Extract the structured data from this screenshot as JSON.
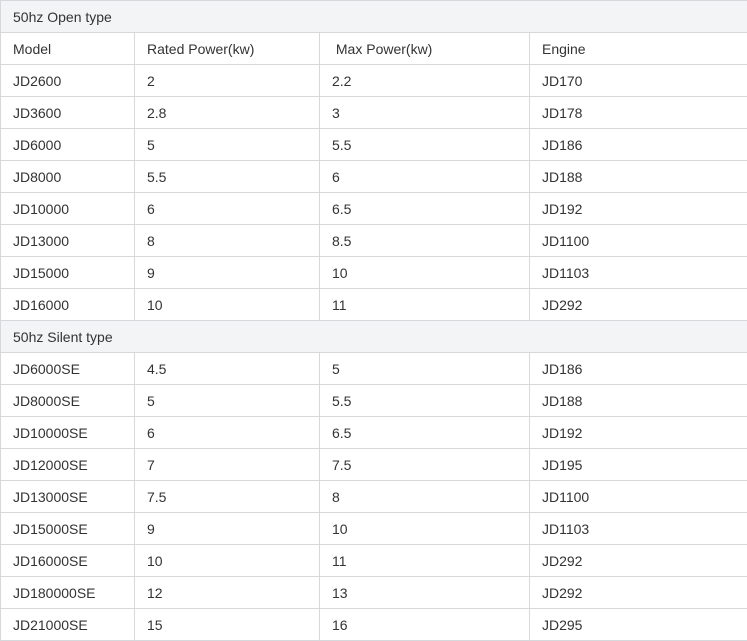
{
  "open_section": {
    "title": "50hz Open type",
    "headers": [
      "Model",
      "Rated Power(kw)",
      " Max Power(kw)",
      "Engine"
    ],
    "rows": [
      [
        "JD2600",
        "2",
        "2.2",
        "JD170"
      ],
      [
        "JD3600",
        "2.8",
        "3",
        "JD178"
      ],
      [
        "JD6000",
        "5",
        "5.5",
        "JD186"
      ],
      [
        "JD8000",
        "5.5",
        "6",
        "JD188"
      ],
      [
        "JD10000",
        "6",
        "6.5",
        "JD192"
      ],
      [
        "JD13000",
        "8",
        "8.5",
        "JD1100"
      ],
      [
        "JD15000",
        "9",
        "10",
        "JD1103"
      ],
      [
        "JD16000",
        "10",
        "11",
        "JD292"
      ]
    ]
  },
  "silent_section": {
    "title": "50hz Silent type",
    "rows": [
      [
        "JD6000SE",
        "4.5",
        "5",
        "JD186"
      ],
      [
        "JD8000SE",
        "5",
        "5.5",
        "JD188"
      ],
      [
        "JD10000SE",
        "6",
        "6.5",
        "JD192"
      ],
      [
        "JD12000SE",
        "7",
        "7.5",
        "JD195"
      ],
      [
        "JD13000SE",
        "7.5",
        "8",
        "JD1100"
      ],
      [
        "JD15000SE",
        "9",
        "10",
        "JD1103"
      ],
      [
        "JD16000SE",
        "10",
        "11",
        "JD292"
      ],
      [
        "JD180000SE",
        "12",
        "13",
        "JD292"
      ],
      [
        "JD21000SE",
        "15",
        "16",
        "JD295"
      ]
    ]
  }
}
